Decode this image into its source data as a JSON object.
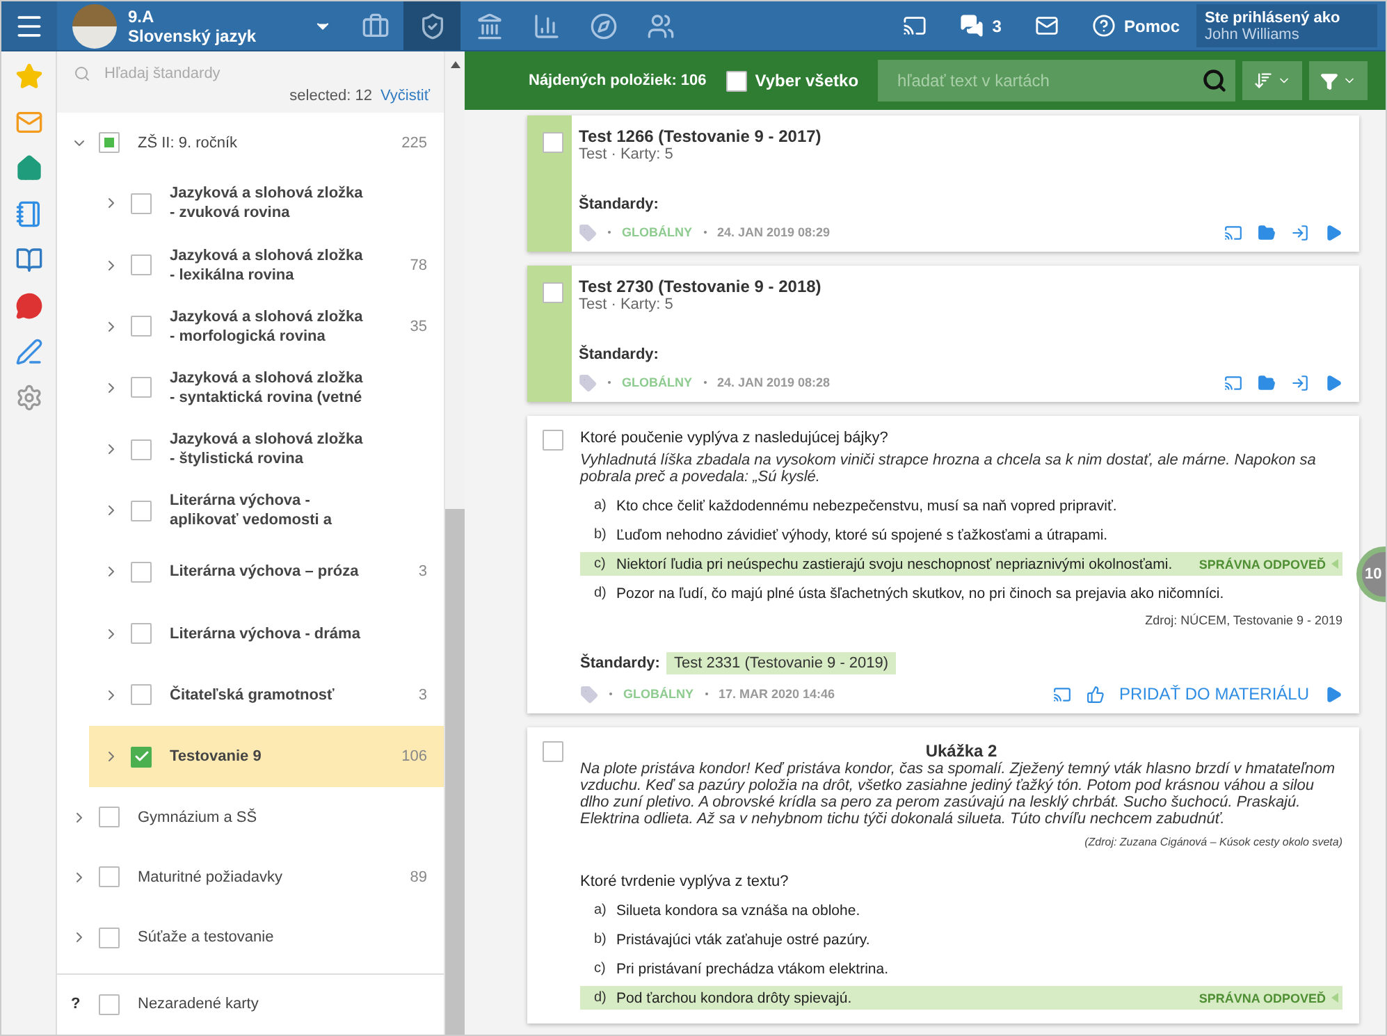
{
  "topbar": {
    "class_name": "9.A",
    "subject": "Slovenský jazyk",
    "nav": [
      {
        "kind": "briefcase",
        "selected": false
      },
      {
        "kind": "shield",
        "selected": true
      },
      {
        "kind": "institution",
        "selected": false
      },
      {
        "kind": "chart",
        "selected": false
      },
      {
        "kind": "compass",
        "selected": false
      },
      {
        "kind": "hikers",
        "selected": false
      }
    ],
    "messages_count": "3",
    "help": "Pomoc",
    "login_label": "Ste prihlásený ako",
    "user": "John Williams"
  },
  "sidebar": {
    "search_placeholder": "Hľadaj štandardy",
    "selected_count": "selected: 12",
    "clear": "Vyčistiť",
    "tree": [
      {
        "label": "ZŠ II: 9. ročník",
        "count": "225",
        "expanded": true,
        "checked": false,
        "partial": true,
        "selected": false,
        "children": [
          {
            "label": "Jazyková a slohová zložka - zvuková rovina",
            "expanded": false,
            "checked": false,
            "selected": false
          },
          {
            "label": "Jazyková a slohová zložka - lexikálna rovina",
            "count": "78",
            "expanded": false,
            "checked": false,
            "selected": false
          },
          {
            "label": "Jazyková a slohová zložka - morfologická rovina",
            "count": "35",
            "expanded": false,
            "checked": false,
            "selected": false
          },
          {
            "label": "Jazyková a slohová zložka - syntaktická rovina (vetné",
            "expanded": false,
            "checked": false,
            "selected": false
          },
          {
            "label": "Jazyková a slohová zložka - štylistická rovina",
            "expanded": false,
            "checked": false,
            "selected": false
          },
          {
            "label": "Literárna výchova - aplikovať vedomosti a",
            "expanded": false,
            "checked": false,
            "selected": false
          },
          {
            "label": "Literárna výchova – próza",
            "count": "3",
            "expanded": false,
            "checked": false,
            "selected": false
          },
          {
            "label": "Literárna výchova - dráma",
            "expanded": false,
            "checked": false,
            "selected": false
          },
          {
            "label": "Čitateľská gramotnosť",
            "count": "3",
            "expanded": false,
            "checked": false,
            "selected": false
          },
          {
            "label": "Testovanie 9",
            "count": "106",
            "expanded": false,
            "checked": true,
            "selected": true
          }
        ]
      },
      {
        "label": "Gymnázium a SŠ",
        "expanded": false,
        "checked": false,
        "selected": false
      },
      {
        "label": "Maturitné požiadavky",
        "count": "89",
        "expanded": false,
        "checked": false,
        "selected": false
      },
      {
        "label": "Súťaže a testovanie",
        "expanded": false,
        "checked": false,
        "selected": false
      }
    ],
    "unsorted": {
      "marker": "?",
      "label": "Nezaradené karty",
      "checked": false
    }
  },
  "toolbar": {
    "found": "Nájdených položiek: 106",
    "select_all": {
      "label": "Vyber všetko",
      "checked": false
    },
    "search_placeholder": "hľadať text v kartách"
  },
  "cards": [
    {
      "kind": "test",
      "checked": false,
      "title": "Test 1266 (Testovanie 9 - 2017)",
      "subtitle": "Test · Karty: 5",
      "standards_label": "Štandardy:",
      "visibility": "GLOBÁLNY",
      "date": "24. JAN 2019 08:29"
    },
    {
      "kind": "test",
      "checked": false,
      "title": "Test 2730 (Testovanie 9 - 2018)",
      "subtitle": "Test · Karty: 5",
      "standards_label": "Štandardy:",
      "visibility": "GLOBÁLNY",
      "date": "24. JAN 2019 08:28"
    },
    {
      "kind": "question",
      "checked": false,
      "question": "Ktoré poučenie vyplýva z nasledujúcej bájky?",
      "passage": "Vyhladnutá líška zbadala na vysokom viniči strapce hrozna a chcela sa k nim dostať, ale márne. Napokon sa pobrala preč a povedala: „Sú kyslé.",
      "options": [
        {
          "letter": "a)",
          "text": "Kto chce čeliť každodennému nebezpečenstvu, musí sa naň vopred pripraviť.",
          "correct": false
        },
        {
          "letter": "b)",
          "text": "Ľuďom nehodno závidieť výhody, ktoré sú spojené s ťažkosťami a útrapami.",
          "correct": false
        },
        {
          "letter": "c)",
          "text": "Niektorí ľudia pri neúspechu zastierajú svoju neschopnosť nepriaznivými okolnosťami.",
          "correct": true
        },
        {
          "letter": "d)",
          "text": "Pozor na ľudí, čo majú plné ústa šľachetných skutkov, no pri činoch sa prejavia ako ničomníci.",
          "correct": false
        }
      ],
      "correct_label": "SPRÁVNA ODPOVEĎ",
      "source": "Zdroj: NÚCEM, Testovanie 9 - 2019",
      "standards_label": "Štandardy:",
      "standard": "Test 2331 (Testovanie 9 - 2019)",
      "visibility": "GLOBÁLNY",
      "date": "17. MAR 2020 14:46",
      "add_button": "PRIDAŤ DO MATERIÁLU"
    },
    {
      "kind": "question",
      "checked": false,
      "heading": "Ukážka 2",
      "passage": "Na plote pristáva kondor! Keď pristáva kondor, čas sa spomalí. Zježený temný vták hlasno brzdí v hmatateľnom vzduchu. Keď sa pazúry položia na drôt, všetko zasiahne jediný ťažký tón. Potom pod krásnou váhou a silou dlho zuní pletivo. A obrovské krídla sa pero za perom zasúvajú na lesklý chrbát. Sucho šuchocú. Praskajú. Elektrina odlieta. Až sa v nehybnom tichu týči dokonalá silueta. Túto chvíľu nechcem zabudnúť.",
      "passage_source": "(Zdroj: Zuzana Cigánová – Kúsok cesty okolo sveta)",
      "question": "Ktoré tvrdenie vyplýva z textu?",
      "options": [
        {
          "letter": "a)",
          "text": "Silueta kondora sa vznáša na oblohe.",
          "correct": false
        },
        {
          "letter": "b)",
          "text": "Pristávajúci vták zaťahuje ostré pazúry.",
          "correct": false
        },
        {
          "letter": "c)",
          "text": "Pri pristávaní prechádza vtákom elektrina.",
          "correct": false
        },
        {
          "letter": "d)",
          "text": "Pod ťarchou kondora drôty spievajú.",
          "correct": true
        }
      ],
      "correct_label": "SPRÁVNA ODPOVEĎ"
    }
  ],
  "badge": "10"
}
